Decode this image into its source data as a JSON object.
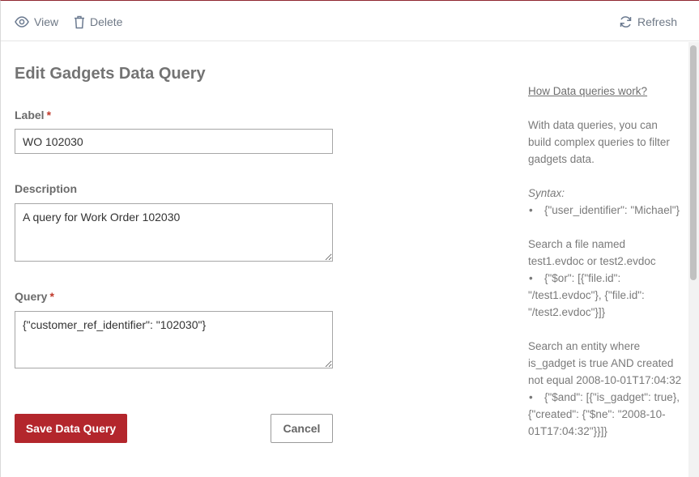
{
  "toolbar": {
    "view_label": "View",
    "delete_label": "Delete",
    "refresh_label": "Refresh"
  },
  "form": {
    "title": "Edit Gadgets Data Query",
    "label_field": {
      "label": "Label",
      "required_mark": "*",
      "value": "WO 102030"
    },
    "description_field": {
      "label": "Description",
      "value": "A query for Work Order 102030"
    },
    "query_field": {
      "label": "Query",
      "required_mark": "*",
      "value": "{\"customer_ref_identifier\": \"102030\"}"
    },
    "save_label": "Save Data Query",
    "cancel_label": "Cancel"
  },
  "help": {
    "link": "How Data queries work?",
    "intro": "With data queries, you can build complex queries to filter gadgets data.",
    "syntax_label": "Syntax:",
    "syntax_example": "{\"user_identifier\": \"Michael\"}",
    "example1_text": "Search a file named test1.evdoc or test2.evdoc",
    "example1_code": "{\"$or\": [{\"file.id\": \"/test1.evdoc\"}, {\"file.id\": \"/test2.evdoc\"}]}",
    "example2_text": "Search an entity where is_gadget is true AND created not equal 2008-10-01T17:04:32",
    "example2_code": "{\"$and\": [{\"is_gadget\": true}, {\"created\": {\"$ne\": \"2008-10-01T17:04:32\"}}]}"
  },
  "colors": {
    "primary_button": "#b3262c",
    "accent_border": "#8f2630",
    "icon": "#6b7a90"
  }
}
